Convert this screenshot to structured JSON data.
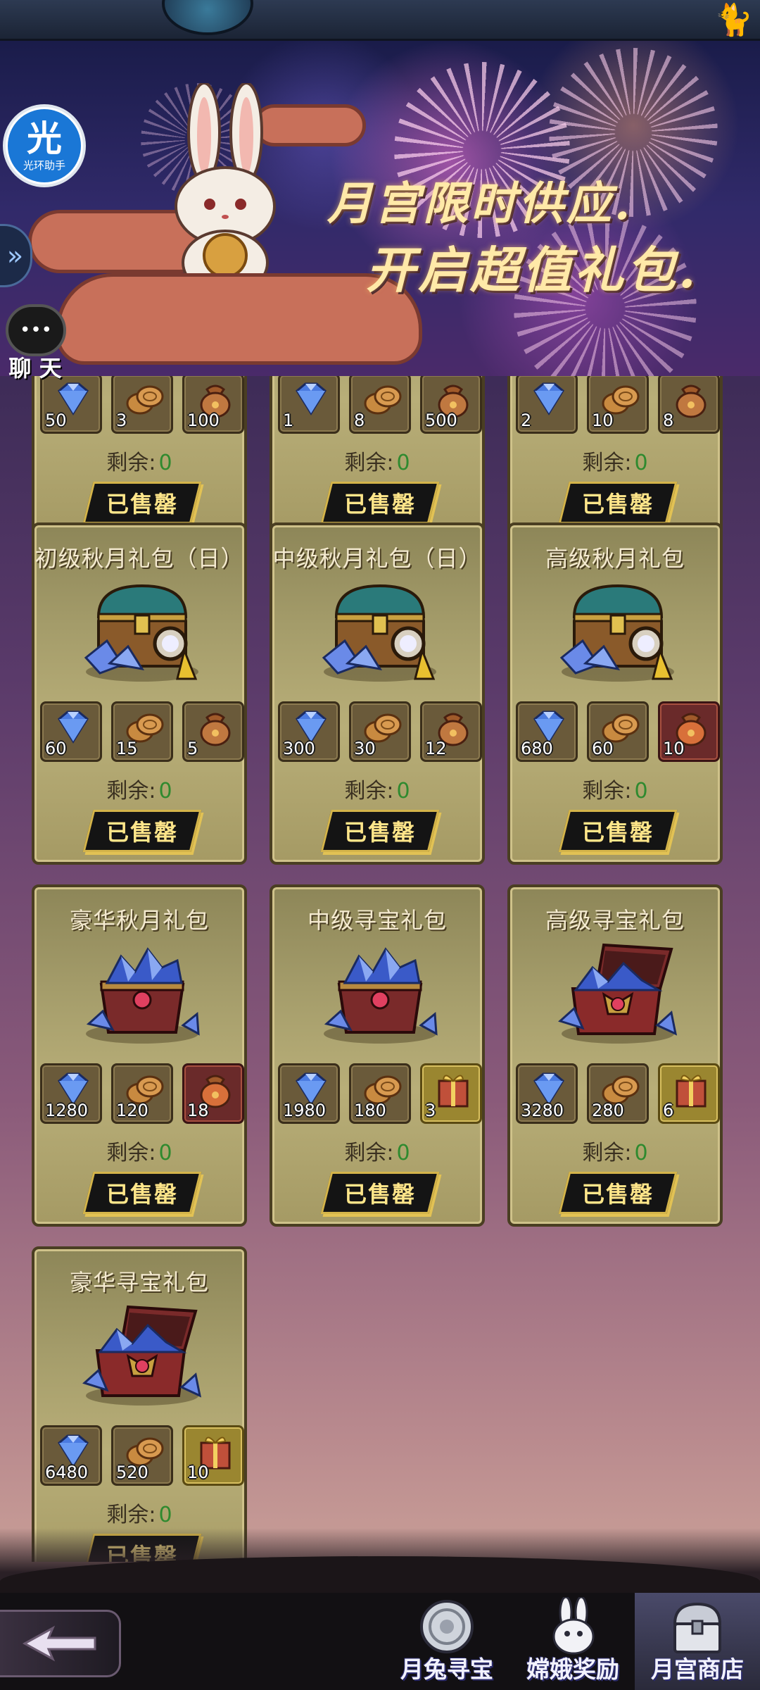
{
  "banner": {
    "title_line1": "月宫限时供应.",
    "title_line2": "开启超值礼包."
  },
  "overlay": {
    "assistant_glyph": "光",
    "assistant_label": "光环助手",
    "expand_glyph": "»",
    "chat_label": "聊 天"
  },
  "shop": {
    "remaining_label": "剩余:",
    "sold_out_label": "已售罄",
    "partial_cards": [
      {
        "remaining": "0",
        "items": [
          {
            "icon": "diamond-icon",
            "count": "50"
          },
          {
            "icon": "coin-icon",
            "count": "3"
          },
          {
            "icon": "bag-icon",
            "count": "100"
          }
        ]
      },
      {
        "remaining": "0",
        "items": [
          {
            "icon": "diamond-icon",
            "count": "1"
          },
          {
            "icon": "coin-icon",
            "count": "8"
          },
          {
            "icon": "bag-icon",
            "count": "500"
          }
        ]
      },
      {
        "remaining": "0",
        "items": [
          {
            "icon": "diamond-icon",
            "count": "2"
          },
          {
            "icon": "coin-icon",
            "count": "10"
          },
          {
            "icon": "bag-icon",
            "count": "8"
          }
        ]
      }
    ],
    "cards": [
      {
        "title": "初级秋月礼包（日）",
        "art": "closed-chest-icon",
        "remaining": "0",
        "items": [
          {
            "icon": "diamond-icon",
            "count": "60"
          },
          {
            "icon": "coin-icon",
            "count": "15"
          },
          {
            "icon": "bag-icon",
            "count": "5"
          }
        ]
      },
      {
        "title": "中级秋月礼包（日）",
        "art": "closed-chest-icon",
        "remaining": "0",
        "items": [
          {
            "icon": "diamond-icon",
            "count": "300"
          },
          {
            "icon": "coin-icon",
            "count": "30"
          },
          {
            "icon": "bag-icon",
            "count": "12"
          }
        ]
      },
      {
        "title": "高级秋月礼包",
        "art": "closed-chest-icon",
        "remaining": "0",
        "items": [
          {
            "icon": "diamond-icon",
            "count": "680"
          },
          {
            "icon": "coin-icon",
            "count": "60"
          },
          {
            "icon": "orange-bag-icon",
            "count": "10"
          }
        ]
      },
      {
        "title": "豪华秋月礼包",
        "art": "gem-chest-icon",
        "remaining": "0",
        "items": [
          {
            "icon": "diamond-icon",
            "count": "1280"
          },
          {
            "icon": "coin-icon",
            "count": "120"
          },
          {
            "icon": "orange-bag-icon",
            "count": "18"
          }
        ]
      },
      {
        "title": "中级寻宝礼包",
        "art": "gem-chest-icon",
        "remaining": "0",
        "items": [
          {
            "icon": "diamond-icon",
            "count": "1980"
          },
          {
            "icon": "coin-icon",
            "count": "180"
          },
          {
            "icon": "gift-box-icon",
            "count": "3"
          }
        ]
      },
      {
        "title": "高级寻宝礼包",
        "art": "open-chest-icon",
        "remaining": "0",
        "items": [
          {
            "icon": "diamond-icon",
            "count": "3280"
          },
          {
            "icon": "coin-icon",
            "count": "280"
          },
          {
            "icon": "gift-box-icon",
            "count": "6"
          }
        ]
      },
      {
        "title": "豪华寻宝礼包",
        "art": "open-chest-icon",
        "remaining": "0",
        "items": [
          {
            "icon": "diamond-icon",
            "count": "6480"
          },
          {
            "icon": "coin-icon",
            "count": "520"
          },
          {
            "icon": "gift-box-icon",
            "count": "10"
          }
        ]
      }
    ]
  },
  "bottom_nav": {
    "back_icon": "back-arrow-icon",
    "tabs": [
      {
        "label": "月兔寻宝",
        "icon": "moon-medallion-icon",
        "active": false
      },
      {
        "label": "嫦娥奖励",
        "icon": "rabbit-icon",
        "active": false
      },
      {
        "label": "月宫商店",
        "icon": "chest-icon",
        "active": true
      }
    ]
  },
  "colors": {
    "remaining_value": "#2f8a2f",
    "sold_out_text": "#ffe68a",
    "card_bg": "#a49c6a",
    "active_tab": "#4a4a6a"
  }
}
